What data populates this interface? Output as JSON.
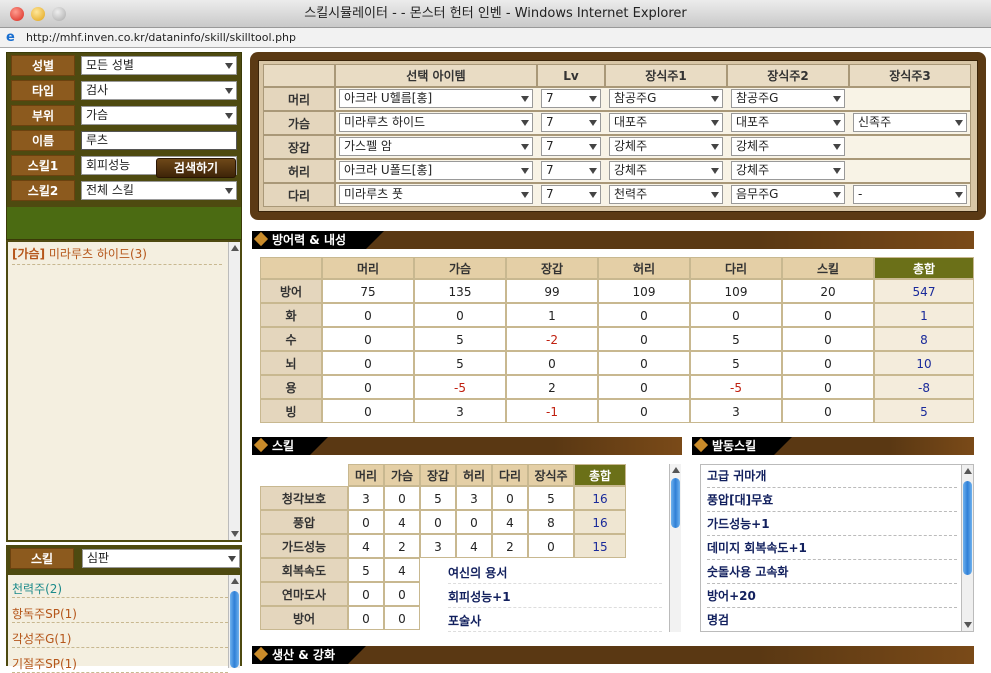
{
  "window": {
    "title": "스킬시뮬레이터 - - 몬스터 헌터 인벤 - Windows Internet Explorer"
  },
  "address": {
    "url": "http://mhf.inven.co.kr/dataninfo/skill/skilltool.php"
  },
  "filters": {
    "rows": [
      {
        "label": "성별",
        "value": "모든 성별"
      },
      {
        "label": "타입",
        "value": "검사"
      },
      {
        "label": "부위",
        "value": "가슴"
      },
      {
        "label": "이름",
        "value": "루츠"
      },
      {
        "label": "스킬1",
        "value": "회피성능"
      },
      {
        "label": "스킬2",
        "value": "전체 스킬"
      }
    ],
    "search_label": "검색하기"
  },
  "results": {
    "part": "[가슴]",
    "name": "미라루츠 하이드(3)"
  },
  "skill_filter": {
    "label": "스킬",
    "value": "심판"
  },
  "jewel_list": [
    "천력주(2)",
    "항독주SP(1)",
    "각성주G(1)",
    "기절주SP(1)"
  ],
  "equipment": {
    "headers": [
      "선택 아이템",
      "Lv",
      "장식주1",
      "장식주2",
      "장식주3"
    ],
    "rows": [
      {
        "part": "머리",
        "item": "아크라 U헬름[홍]",
        "lv": "7",
        "j1": "참공주G",
        "j2": "참공주G",
        "j3": ""
      },
      {
        "part": "가슴",
        "item": "미라루츠 하이드",
        "lv": "7",
        "j1": "대포주",
        "j2": "대포주",
        "j3": "신족주"
      },
      {
        "part": "장갑",
        "item": "가스펠 암",
        "lv": "7",
        "j1": "강체주",
        "j2": "강체주",
        "j3": ""
      },
      {
        "part": "허리",
        "item": "아크라 U폴드[홍]",
        "lv": "7",
        "j1": "강체주",
        "j2": "강체주",
        "j3": ""
      },
      {
        "part": "다리",
        "item": "미라루츠 풋",
        "lv": "7",
        "j1": "천력주",
        "j2": "음무주G",
        "j3": "-"
      }
    ]
  },
  "defense": {
    "title": "방어력 & 내성",
    "headers": [
      "머리",
      "가슴",
      "장갑",
      "허리",
      "다리",
      "스킬",
      "총합"
    ],
    "rows": [
      {
        "label": "방어",
        "values": [
          "75",
          "135",
          "99",
          "109",
          "109",
          "20",
          "547"
        ]
      },
      {
        "label": "화",
        "values": [
          "0",
          "0",
          "1",
          "0",
          "0",
          "0",
          "1"
        ]
      },
      {
        "label": "수",
        "values": [
          "0",
          "5",
          "-2",
          "0",
          "5",
          "0",
          "8"
        ]
      },
      {
        "label": "뇌",
        "values": [
          "0",
          "5",
          "0",
          "0",
          "5",
          "0",
          "10"
        ]
      },
      {
        "label": "용",
        "values": [
          "0",
          "-5",
          "2",
          "0",
          "-5",
          "0",
          "-8"
        ]
      },
      {
        "label": "빙",
        "values": [
          "0",
          "3",
          "-1",
          "0",
          "3",
          "0",
          "5"
        ]
      }
    ]
  },
  "skills": {
    "title": "스킬",
    "headers": [
      "머리",
      "가슴",
      "장갑",
      "허리",
      "다리",
      "장식주",
      "총합"
    ],
    "rows": [
      {
        "label": "청각보호",
        "values": [
          "3",
          "0",
          "5",
          "3",
          "0",
          "5",
          "16"
        ]
      },
      {
        "label": "풍압",
        "values": [
          "0",
          "4",
          "0",
          "0",
          "4",
          "8",
          "16"
        ]
      },
      {
        "label": "가드성능",
        "values": [
          "4",
          "2",
          "3",
          "4",
          "2",
          "0",
          "15"
        ]
      },
      {
        "label": "회복속도",
        "values": [
          "5",
          "4"
        ]
      },
      {
        "label": "연마도사",
        "values": [
          "0",
          "0"
        ]
      },
      {
        "label": "방어",
        "values": [
          "0",
          "0"
        ]
      }
    ],
    "tooltip": [
      "여신의 용서",
      "회피성능+1",
      "포술사"
    ]
  },
  "active_skills": {
    "title": "발동스킬",
    "items": [
      "고급 귀마개",
      "풍압[대]무효",
      "가드성능+1",
      "데미지 회복속도+1",
      "숫돌사용 고속화",
      "방어+20",
      "명검"
    ]
  },
  "production": {
    "title": "생산 & 강화"
  }
}
